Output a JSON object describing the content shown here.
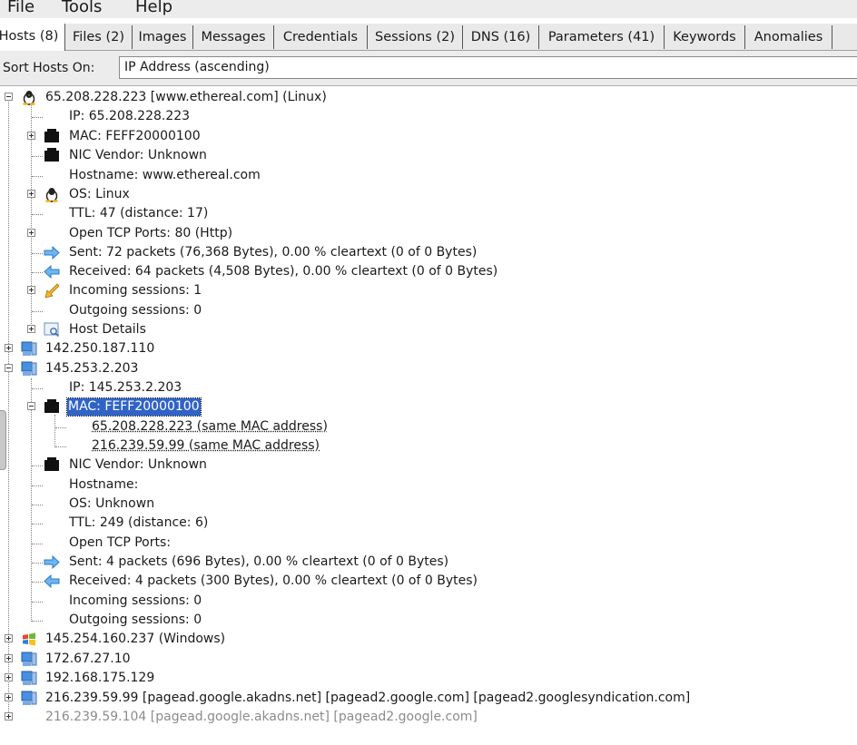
{
  "menu": {
    "file": "File",
    "tools": "Tools",
    "help": "Help"
  },
  "tabs": [
    {
      "label": "Hosts (8)"
    },
    {
      "label": "Files (2)"
    },
    {
      "label": "Images"
    },
    {
      "label": "Messages"
    },
    {
      "label": "Credentials"
    },
    {
      "label": "Sessions (2)"
    },
    {
      "label": "DNS (16)"
    },
    {
      "label": "Parameters (41)"
    },
    {
      "label": "Keywords"
    },
    {
      "label": "Anomalies"
    }
  ],
  "sort": {
    "label": "Sort Hosts On:",
    "value": "IP Address (ascending)"
  },
  "tree": {
    "host1": {
      "title": "65.208.228.223 [www.ethereal.com] (Linux)",
      "ip": "IP: 65.208.228.223",
      "mac": "MAC: FEFF20000100",
      "nic": "NIC Vendor: Unknown",
      "hostname": "Hostname: www.ethereal.com",
      "os": "OS: Linux",
      "ttl": "TTL: 47 (distance: 17)",
      "ports": "Open TCP Ports: 80 (Http)",
      "sent": "Sent: 72 packets (76,368 Bytes), 0.00 % cleartext (0 of 0 Bytes)",
      "received": "Received: 64 packets (4,508 Bytes), 0.00 % cleartext (0 of 0 Bytes)",
      "incoming": "Incoming sessions: 1",
      "outgoing": "Outgoing sessions: 0",
      "details": "Host Details"
    },
    "host2": {
      "title": "142.250.187.110"
    },
    "host3": {
      "title": "145.253.2.203",
      "ip": "IP: 145.253.2.203",
      "mac": "MAC: FEFF20000100",
      "mac_child1": "65.208.228.223 (same MAC address)",
      "mac_child2": "216.239.59.99 (same MAC address)",
      "nic": "NIC Vendor: Unknown",
      "hostname": "Hostname:",
      "os": "OS: Unknown",
      "ttl": "TTL: 249 (distance: 6)",
      "ports": "Open TCP Ports:",
      "sent": "Sent: 4 packets (696 Bytes), 0.00 % cleartext (0 of 0 Bytes)",
      "received": "Received: 4 packets (300 Bytes), 0.00 % cleartext (0 of 0 Bytes)",
      "incoming": "Incoming sessions: 0",
      "outgoing": "Outgoing sessions: 0"
    },
    "host4": {
      "title": "145.254.160.237 (Windows)"
    },
    "host5": {
      "title": "172.67.27.10"
    },
    "host6": {
      "title": "192.168.175.129"
    },
    "host7": {
      "title": "216.239.59.99 [pagead.google.akadns.net] [pagead2.google.com] [pagead2.googlesyndication.com]"
    },
    "host8": {
      "title": "216.239.59.104 [pagead.google.akadns.net] [pagead2.google.com]"
    }
  },
  "colors": {
    "selection": "#2f63c7",
    "dim_text": "#8c8c8c",
    "sent_arrow": "#3a8be0",
    "received_arrow": "#3a8be0"
  }
}
